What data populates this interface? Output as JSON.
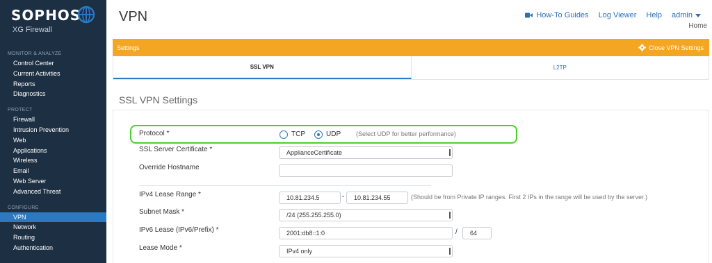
{
  "sidebar": {
    "brand": "SOPHOS",
    "product": "XG Firewall",
    "sections": [
      {
        "title": "MONITOR & ANALYZE",
        "items": [
          "Control Center",
          "Current Activities",
          "Reports",
          "Diagnostics"
        ]
      },
      {
        "title": "PROTECT",
        "items": [
          "Firewall",
          "Intrusion Prevention",
          "Web",
          "Applications",
          "Wireless",
          "Email",
          "Web Server",
          "Advanced Threat"
        ]
      },
      {
        "title": "CONFIGURE",
        "items": [
          "VPN",
          "Network",
          "Routing",
          "Authentication"
        ]
      }
    ],
    "active_item": "VPN"
  },
  "header": {
    "title": "VPN",
    "links": {
      "howto": "How-To Guides",
      "logviewer": "Log Viewer",
      "help": "Help",
      "admin": "admin"
    },
    "breadcrumb": "Home"
  },
  "settings_bar": {
    "label": "Settings",
    "close_label": "Close VPN Settings"
  },
  "tabs": [
    {
      "label": "SSL VPN",
      "active": true
    },
    {
      "label": "L2TP",
      "active": false
    }
  ],
  "section_title": "SSL VPN Settings",
  "form": {
    "protocol": {
      "label": "Protocol *",
      "options": [
        "TCP",
        "UDP"
      ],
      "selected": "UDP",
      "hint": "(Select UDP for better performance)"
    },
    "certificate": {
      "label": "SSL Server Certificate *",
      "value": "ApplianceCertificate"
    },
    "hostname": {
      "label": "Override Hostname",
      "value": ""
    },
    "lease_range": {
      "label": "IPv4 Lease Range *",
      "start": "10.81.234.5",
      "sep": "-",
      "end": "10.81.234.55",
      "hint": "(Should be from Private IP ranges. First 2 IPs in the range will be used by the server.)"
    },
    "subnet": {
      "label": "Subnet Mask *",
      "value": "/24 (255.255.255.0)"
    },
    "ipv6": {
      "label": "IPv6 Lease (IPv6/Prefix) *",
      "address": "2001:db8::1:0",
      "sep": "/",
      "prefix": "64"
    },
    "lease_mode": {
      "label": "Lease Mode *",
      "value": "IPv4 only"
    }
  },
  "colors": {
    "sidebar_bg": "#1d2f43",
    "accent_blue": "#2b79c2",
    "orange": "#f4a623",
    "highlight_green": "#48d12b"
  }
}
